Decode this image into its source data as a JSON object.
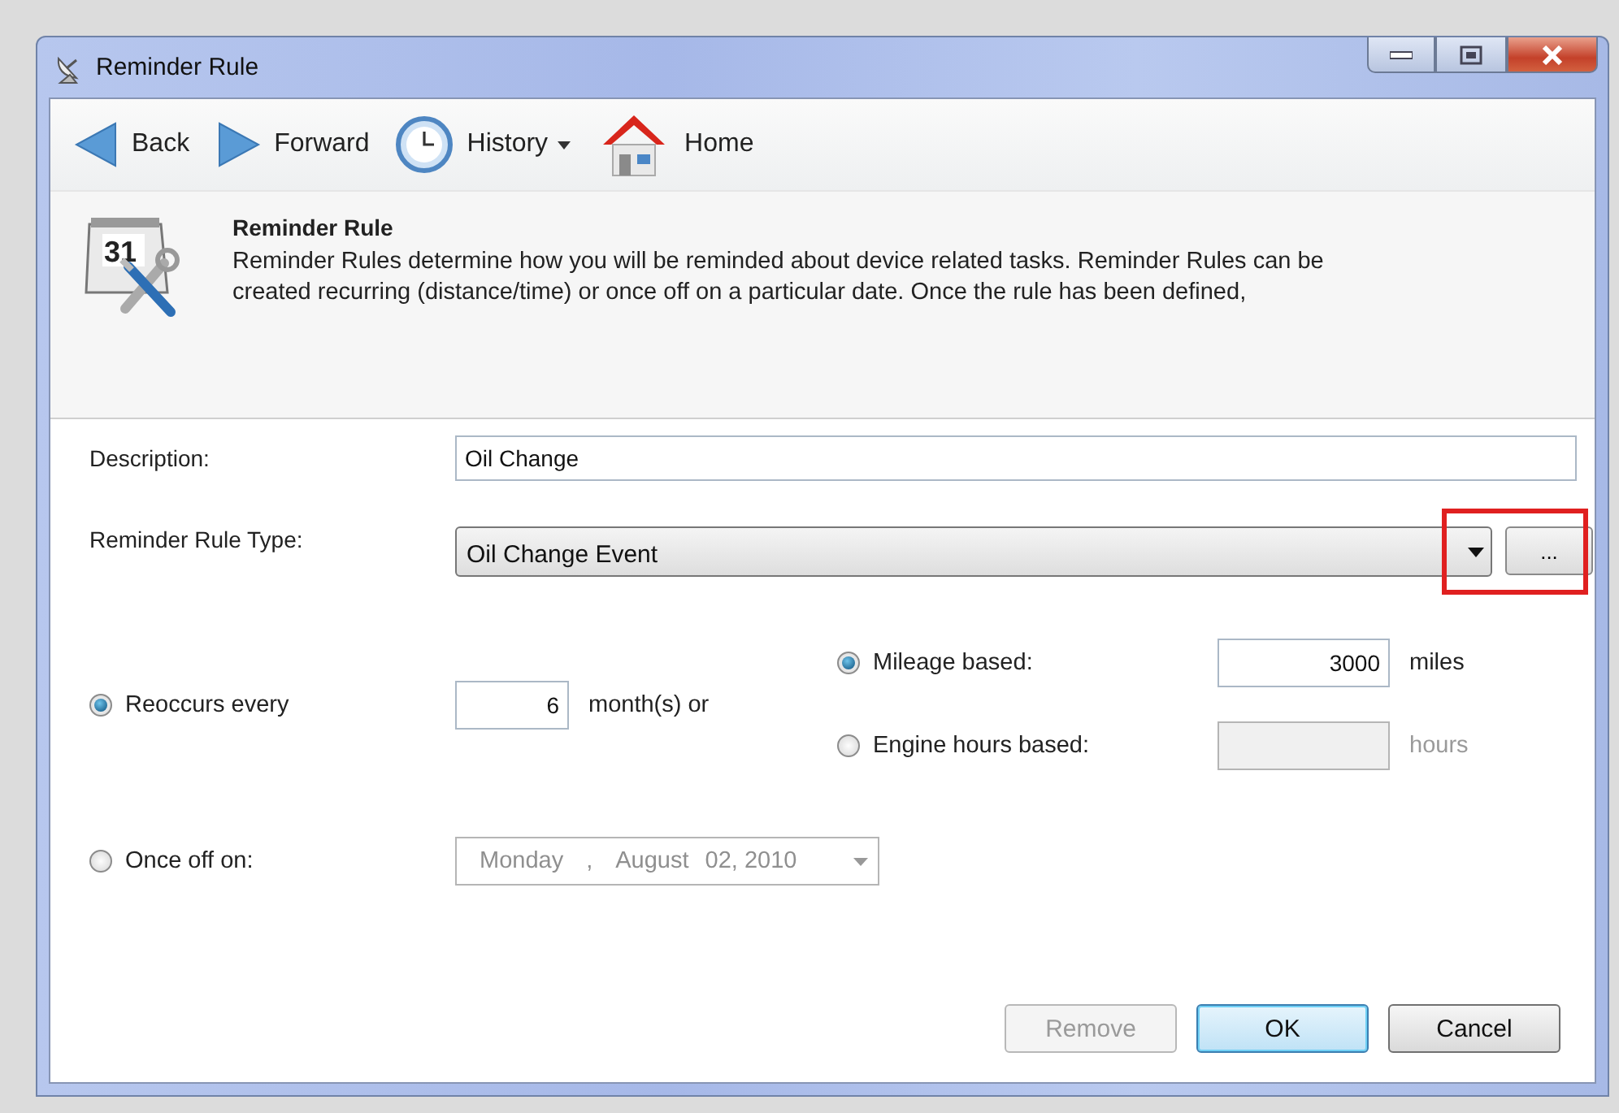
{
  "window": {
    "title": "Reminder Rule"
  },
  "toolbar": [
    {
      "kind": "back",
      "label": "Back"
    },
    {
      "kind": "forward",
      "label": "Forward"
    },
    {
      "kind": "history",
      "label": "History"
    },
    {
      "kind": "home",
      "label": "Home"
    }
  ],
  "header": {
    "icon_date": "31",
    "title": "Reminder Rule",
    "description": "Reminder Rules determine how you will be reminded about device related tasks. Reminder Rules can be created recurring (distance/time) or once off on a particular date. Once the rule has been defined,"
  },
  "description": {
    "label": "Description:",
    "value": "Oil Change"
  },
  "rule_type": {
    "label": "Reminder Rule Type:",
    "value": "Oil Change Event",
    "browse": "...",
    "highlighted": true
  },
  "recurrence": [
    {
      "label": "Reoccurs every",
      "selected": true
    },
    {
      "label": "Once off on:",
      "selected": false
    }
  ],
  "interval": {
    "value": "6",
    "unit": "month(s) or"
  },
  "basis": [
    {
      "label": "Mileage based:",
      "selected": true,
      "value": "3000",
      "unit": "miles",
      "disabled": false
    },
    {
      "label": "Engine hours based:",
      "selected": false,
      "unit": "hours",
      "disabled": true
    }
  ],
  "date": {
    "weekday": "Monday",
    "separator": ",",
    "month": "August",
    "day": "02, 2010",
    "disabled": true
  },
  "buttons": [
    {
      "label": "Remove",
      "disabled": true,
      "default": false
    },
    {
      "label": "OK",
      "disabled": false,
      "default": true
    },
    {
      "label": "Cancel",
      "disabled": false,
      "default": false
    }
  ]
}
